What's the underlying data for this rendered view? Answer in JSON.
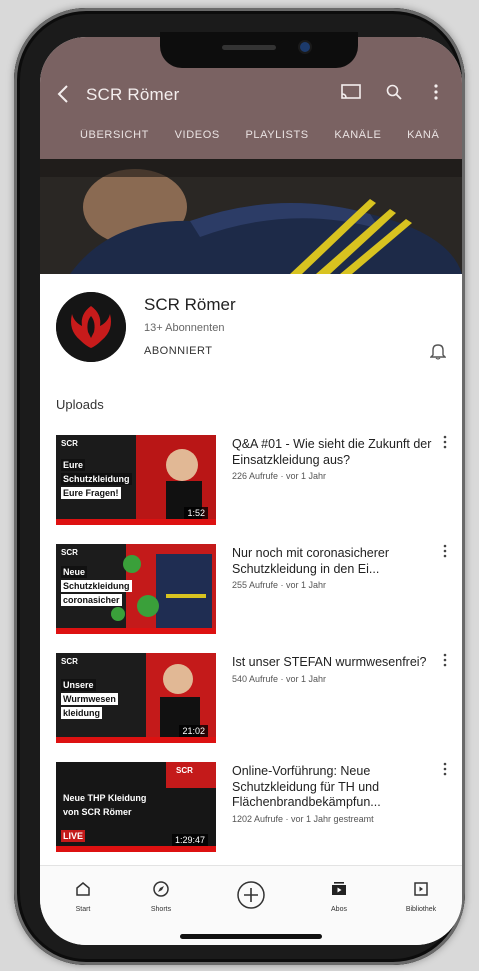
{
  "header": {
    "back_icon": "arrow-left-icon",
    "title": "SCR Römer",
    "actions": [
      "cast-icon",
      "search-icon",
      "more-vert-icon"
    ]
  },
  "tabs": [
    "ÜBERSICHT",
    "VIDEOS",
    "PLAYLISTS",
    "KANÄLE",
    "KANÄ"
  ],
  "channel": {
    "name": "SCR Römer",
    "subscribers": "13+ Abonnenten",
    "subscribe_state": "ABONNIERT",
    "bell_icon": "bell-icon"
  },
  "section": {
    "title": "Uploads"
  },
  "videos": [
    {
      "title": "Q&A #01 - Wie sieht die Zukunft der Einsatzkleidung aus?",
      "meta": "226 Aufrufe · vor 1 Jahr",
      "duration": "1:52",
      "thumb_text": [
        "Eure",
        "Schutzkleidung",
        "Eure Fragen!"
      ]
    },
    {
      "title": "Nur noch mit coronasicherer Schutzkleidung in den Ei...",
      "meta": "255 Aufrufe · vor 1 Jahr",
      "duration": "",
      "thumb_text": [
        "Neue",
        "Schutzkleidung",
        "coronasicher"
      ]
    },
    {
      "title": "Ist unser STEFAN wurmwesenfrei?",
      "meta": "540 Aufrufe · vor 1 Jahr",
      "duration": "21:02",
      "thumb_text": [
        "Unsere",
        "Wurmwesen",
        "kleidung"
      ]
    },
    {
      "title": "Online-Vorführung: Neue Schutzkleidung für TH und Flächenbrandbekämpfun...",
      "meta": "1202 Aufrufe · vor 1 Jahr gestreamt",
      "duration": "1:29:47",
      "thumb_text": [
        "Neue THP Kleidung",
        "von SCR Römer",
        "LIVE"
      ]
    }
  ],
  "bottom_nav": [
    {
      "icon": "home-icon",
      "label": "Start"
    },
    {
      "icon": "explore-icon",
      "label": "Shorts"
    },
    {
      "icon": "add-circle-icon",
      "label": ""
    },
    {
      "icon": "subscriptions-icon",
      "label": "Abos"
    },
    {
      "icon": "library-icon",
      "label": "Bibliothek"
    }
  ],
  "colors": {
    "header": "#7a6262",
    "accent": "#c71b1b",
    "avatar_bg": "#151515"
  }
}
